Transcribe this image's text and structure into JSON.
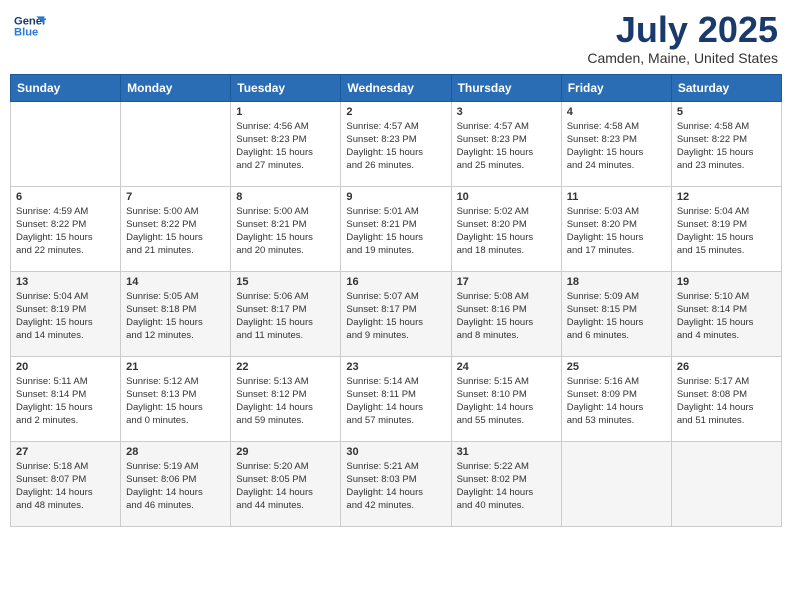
{
  "header": {
    "logo_line1": "General",
    "logo_line2": "Blue",
    "month_year": "July 2025",
    "location": "Camden, Maine, United States"
  },
  "days_of_week": [
    "Sunday",
    "Monday",
    "Tuesday",
    "Wednesday",
    "Thursday",
    "Friday",
    "Saturday"
  ],
  "weeks": [
    [
      {
        "day": "",
        "info": ""
      },
      {
        "day": "",
        "info": ""
      },
      {
        "day": "1",
        "info": "Sunrise: 4:56 AM\nSunset: 8:23 PM\nDaylight: 15 hours\nand 27 minutes."
      },
      {
        "day": "2",
        "info": "Sunrise: 4:57 AM\nSunset: 8:23 PM\nDaylight: 15 hours\nand 26 minutes."
      },
      {
        "day": "3",
        "info": "Sunrise: 4:57 AM\nSunset: 8:23 PM\nDaylight: 15 hours\nand 25 minutes."
      },
      {
        "day": "4",
        "info": "Sunrise: 4:58 AM\nSunset: 8:23 PM\nDaylight: 15 hours\nand 24 minutes."
      },
      {
        "day": "5",
        "info": "Sunrise: 4:58 AM\nSunset: 8:22 PM\nDaylight: 15 hours\nand 23 minutes."
      }
    ],
    [
      {
        "day": "6",
        "info": "Sunrise: 4:59 AM\nSunset: 8:22 PM\nDaylight: 15 hours\nand 22 minutes."
      },
      {
        "day": "7",
        "info": "Sunrise: 5:00 AM\nSunset: 8:22 PM\nDaylight: 15 hours\nand 21 minutes."
      },
      {
        "day": "8",
        "info": "Sunrise: 5:00 AM\nSunset: 8:21 PM\nDaylight: 15 hours\nand 20 minutes."
      },
      {
        "day": "9",
        "info": "Sunrise: 5:01 AM\nSunset: 8:21 PM\nDaylight: 15 hours\nand 19 minutes."
      },
      {
        "day": "10",
        "info": "Sunrise: 5:02 AM\nSunset: 8:20 PM\nDaylight: 15 hours\nand 18 minutes."
      },
      {
        "day": "11",
        "info": "Sunrise: 5:03 AM\nSunset: 8:20 PM\nDaylight: 15 hours\nand 17 minutes."
      },
      {
        "day": "12",
        "info": "Sunrise: 5:04 AM\nSunset: 8:19 PM\nDaylight: 15 hours\nand 15 minutes."
      }
    ],
    [
      {
        "day": "13",
        "info": "Sunrise: 5:04 AM\nSunset: 8:19 PM\nDaylight: 15 hours\nand 14 minutes."
      },
      {
        "day": "14",
        "info": "Sunrise: 5:05 AM\nSunset: 8:18 PM\nDaylight: 15 hours\nand 12 minutes."
      },
      {
        "day": "15",
        "info": "Sunrise: 5:06 AM\nSunset: 8:17 PM\nDaylight: 15 hours\nand 11 minutes."
      },
      {
        "day": "16",
        "info": "Sunrise: 5:07 AM\nSunset: 8:17 PM\nDaylight: 15 hours\nand 9 minutes."
      },
      {
        "day": "17",
        "info": "Sunrise: 5:08 AM\nSunset: 8:16 PM\nDaylight: 15 hours\nand 8 minutes."
      },
      {
        "day": "18",
        "info": "Sunrise: 5:09 AM\nSunset: 8:15 PM\nDaylight: 15 hours\nand 6 minutes."
      },
      {
        "day": "19",
        "info": "Sunrise: 5:10 AM\nSunset: 8:14 PM\nDaylight: 15 hours\nand 4 minutes."
      }
    ],
    [
      {
        "day": "20",
        "info": "Sunrise: 5:11 AM\nSunset: 8:14 PM\nDaylight: 15 hours\nand 2 minutes."
      },
      {
        "day": "21",
        "info": "Sunrise: 5:12 AM\nSunset: 8:13 PM\nDaylight: 15 hours\nand 0 minutes."
      },
      {
        "day": "22",
        "info": "Sunrise: 5:13 AM\nSunset: 8:12 PM\nDaylight: 14 hours\nand 59 minutes."
      },
      {
        "day": "23",
        "info": "Sunrise: 5:14 AM\nSunset: 8:11 PM\nDaylight: 14 hours\nand 57 minutes."
      },
      {
        "day": "24",
        "info": "Sunrise: 5:15 AM\nSunset: 8:10 PM\nDaylight: 14 hours\nand 55 minutes."
      },
      {
        "day": "25",
        "info": "Sunrise: 5:16 AM\nSunset: 8:09 PM\nDaylight: 14 hours\nand 53 minutes."
      },
      {
        "day": "26",
        "info": "Sunrise: 5:17 AM\nSunset: 8:08 PM\nDaylight: 14 hours\nand 51 minutes."
      }
    ],
    [
      {
        "day": "27",
        "info": "Sunrise: 5:18 AM\nSunset: 8:07 PM\nDaylight: 14 hours\nand 48 minutes."
      },
      {
        "day": "28",
        "info": "Sunrise: 5:19 AM\nSunset: 8:06 PM\nDaylight: 14 hours\nand 46 minutes."
      },
      {
        "day": "29",
        "info": "Sunrise: 5:20 AM\nSunset: 8:05 PM\nDaylight: 14 hours\nand 44 minutes."
      },
      {
        "day": "30",
        "info": "Sunrise: 5:21 AM\nSunset: 8:03 PM\nDaylight: 14 hours\nand 42 minutes."
      },
      {
        "day": "31",
        "info": "Sunrise: 5:22 AM\nSunset: 8:02 PM\nDaylight: 14 hours\nand 40 minutes."
      },
      {
        "day": "",
        "info": ""
      },
      {
        "day": "",
        "info": ""
      }
    ]
  ]
}
